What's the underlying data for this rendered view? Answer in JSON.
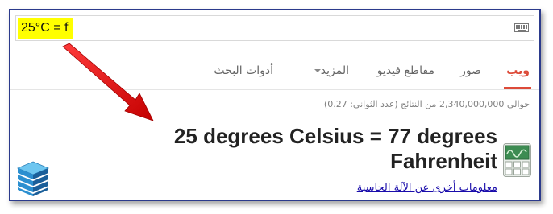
{
  "search": {
    "query": "25°C = f"
  },
  "tabs": [
    {
      "label": "ويب",
      "active": true
    },
    {
      "label": "صور",
      "active": false
    },
    {
      "label": "مقاطع فيديو",
      "active": false
    },
    {
      "label": "المزيد",
      "active": false
    },
    {
      "label": "أدوات البحث",
      "active": false
    }
  ],
  "results": {
    "stats": "حوالي 2,340,000,000 من النتائج (عدد الثواني: 0.27)"
  },
  "answer": {
    "text": "25 degrees Celsius = 77 degrees Fahrenheit",
    "more_link": "معلومات أخرى عن الآلة الحاسبة"
  },
  "colors": {
    "frame_border": "#2b3a8c",
    "highlight": "#ffff00",
    "active_tab": "#dd4b39",
    "link": "#1a0dab",
    "arrow": "#e01010"
  },
  "icons": {
    "keyboard": "keyboard-icon",
    "calculator": "calculator-icon",
    "logo": "cube-stack-logo",
    "arrow": "red-annotation-arrow"
  }
}
